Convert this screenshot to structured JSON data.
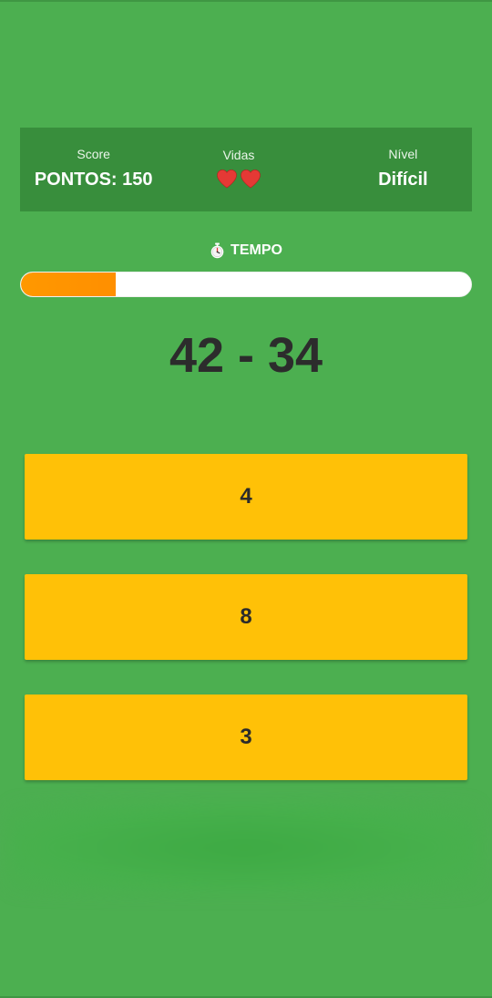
{
  "status": {
    "score_label": "Score",
    "score_value": "PONTOS: 150",
    "lives_label": "Vidas",
    "lives_count": 2,
    "level_label": "Nível",
    "level_value": "Difícil"
  },
  "timer": {
    "icon": "stopwatch-icon",
    "label": "TEMPO",
    "remaining_fraction": 0.21
  },
  "question": {
    "text": "42 - 34"
  },
  "answers": [
    {
      "label": "4"
    },
    {
      "label": "8"
    },
    {
      "label": "3"
    }
  ],
  "colors": {
    "background": "#4caf50",
    "panel": "#388e3c",
    "answer_button": "#ffc107",
    "timer_fill": "#ff9800",
    "heart": "#e53935"
  }
}
